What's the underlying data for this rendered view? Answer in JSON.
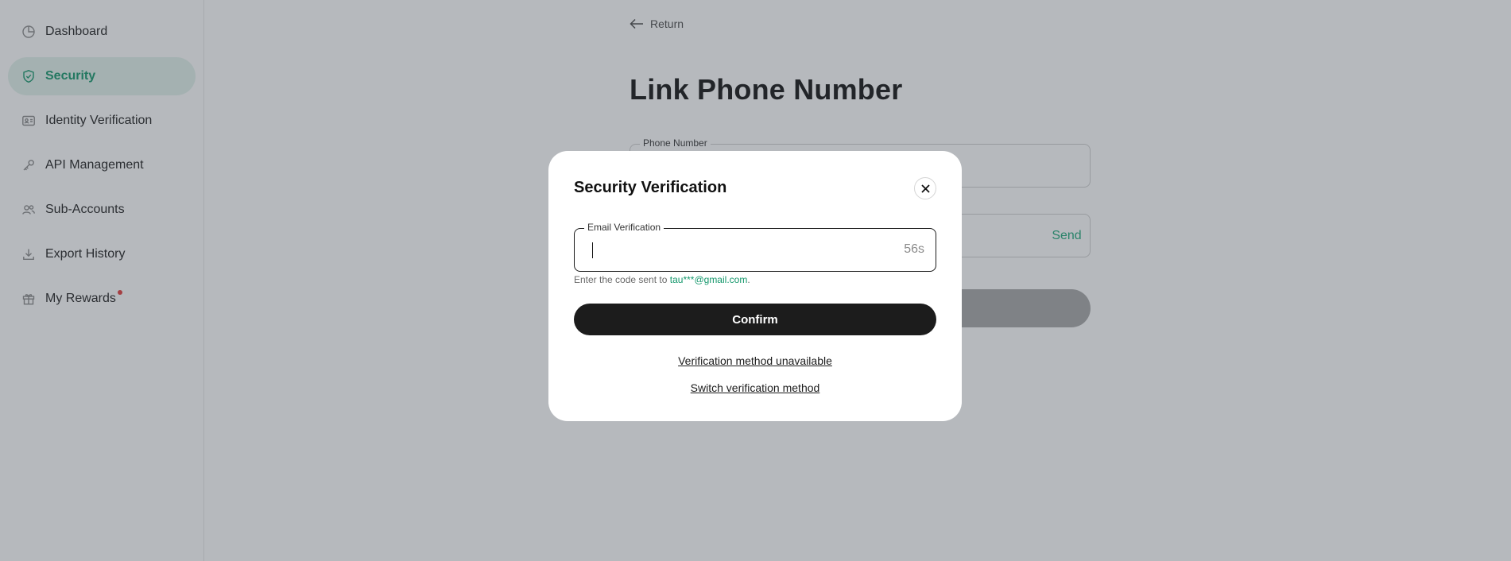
{
  "sidebar": {
    "items": [
      {
        "label": "Dashboard",
        "icon": "dashboard-icon",
        "active": false
      },
      {
        "label": "Security",
        "icon": "shield-icon",
        "active": true
      },
      {
        "label": "Identity Verification",
        "icon": "id-card-icon",
        "active": false
      },
      {
        "label": "API Management",
        "icon": "api-key-icon",
        "active": false
      },
      {
        "label": "Sub-Accounts",
        "icon": "users-icon",
        "active": false
      },
      {
        "label": "Export History",
        "icon": "download-icon",
        "active": false
      },
      {
        "label": "My Rewards",
        "icon": "gift-icon",
        "active": false,
        "badge": "red-dot"
      }
    ]
  },
  "main": {
    "return_label": "Return",
    "title": "Link Phone Number",
    "phone_field_label": "Phone Number",
    "send_label": "Send"
  },
  "modal": {
    "title": "Security Verification",
    "field_label": "Email Verification",
    "input_value": "",
    "countdown": "56s",
    "hint_prefix": "Enter the code sent to",
    "hint_email": "tau***@gmail.com",
    "hint_suffix": ".",
    "confirm_label": "Confirm",
    "link_unavailable": "Verification method unavailable",
    "link_switch": "Switch verification method"
  },
  "colors": {
    "accent": "#14976b",
    "active_bg": "#e3f3ec",
    "dark_button": "#1c1c1c",
    "overlay": "rgba(62,70,82,0.38)"
  }
}
